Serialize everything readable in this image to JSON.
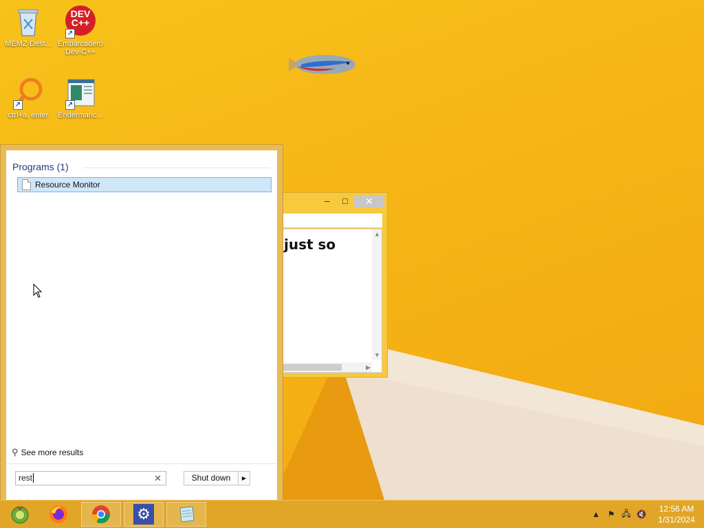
{
  "desktop": {
    "icons": [
      {
        "label": "MEMZ-Dest..."
      },
      {
        "label": "Embarcadero Dev-C++",
        "badge": "DEV C++"
      },
      {
        "label": "ctrl+a, enter"
      },
      {
        "label": "Endermanc..."
      }
    ]
  },
  "bg_window": {
    "min": "–",
    "max": "□",
    "close": "✕",
    "content_text": "just so"
  },
  "start_menu": {
    "programs_header": "Programs (1)",
    "results": [
      {
        "label": "Resource Monitor"
      }
    ],
    "see_more": "See more results",
    "search": {
      "value": "rest",
      "clear": "✕"
    },
    "shutdown_label": "Shut down",
    "shutdown_arrow": "▶"
  },
  "taskbar": {
    "items": [
      "start-orb",
      "firefox",
      "chrome",
      "settings",
      "notepad"
    ],
    "tray": {
      "time": "12:56 AM",
      "date": "1/31/2024"
    }
  },
  "colors": {
    "wallpaper": "#f5b516",
    "taskbar": "#e1a628",
    "selection": "#cfe7f8"
  }
}
